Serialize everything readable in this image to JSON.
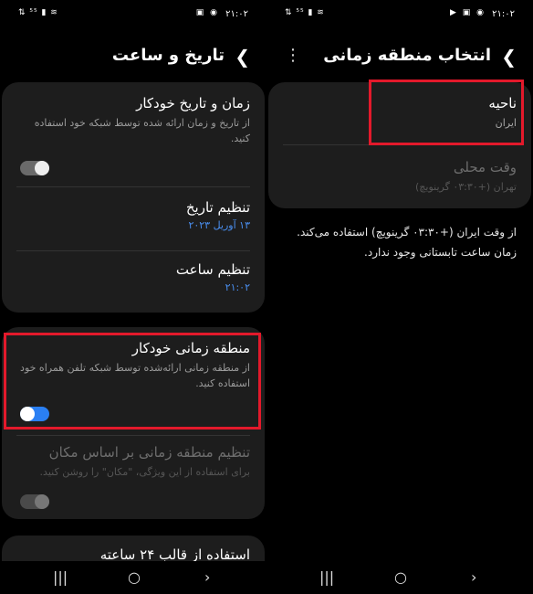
{
  "left_screen": {
    "status": {
      "time": "۲۱:۰۲",
      "left_icons": "⇅ ⁵⁵ ▮ ≋",
      "right_icons": "▣ ◉"
    },
    "header": {
      "title": "تاریخ و ساعت",
      "back_icon": "chevron-right-icon"
    },
    "card1": {
      "auto_datetime": {
        "title": "زمان و تاریخ خودکار",
        "subtitle": "از تاریخ و زمان ارائه شده توسط شبکه خود استفاده کنید."
      },
      "set_date": {
        "title": "تنظیم تاریخ",
        "value": "۱۳ آوریل ۲۰۲۳"
      },
      "set_time": {
        "title": "تنظیم ساعت",
        "value": "۲۱:۰۲"
      }
    },
    "card2": {
      "auto_timezone": {
        "title": "منطقه زمانی خودکار",
        "subtitle": "از منطقه زمانی ارائه‌شده توسط شبکه تلفن همراه خود استفاده کنید."
      },
      "location_timezone": {
        "title": "تنظیم منطقه زمانی بر اساس مکان",
        "subtitle": "برای استفاده از این ویژگی، \"مکان\" را روشن کنید."
      }
    },
    "card3": {
      "format24": {
        "title": "استفاده از قالب ۲۴ ساعته"
      }
    }
  },
  "right_screen": {
    "status": {
      "time": "۲۱:۰۲",
      "left_icons": "⇅ ⁵⁵ ▮ ≋",
      "right_icons": "▶ ▣ ◉"
    },
    "header": {
      "title": "انتخاب منطقه زمانی",
      "back_icon": "chevron-right-icon",
      "more_icon": "more-vertical-icon"
    },
    "region": {
      "title": "ناحیه",
      "value": "ایران"
    },
    "local_time": {
      "title": "وقت محلی",
      "value": "تهران (+۰۳:۳۰ گرینویچ)"
    },
    "description_line1": "از وقت ایران (+۰۳:۳۰ گرینویچ) استفاده می‌کند.",
    "description_line2": "زمان ساعت تابستانی وجود ندارد."
  },
  "navbar": {
    "recents": "|||",
    "home": "○",
    "back": "›"
  },
  "colors": {
    "accent": "#2a7ff3",
    "highlight": "#e3192b",
    "card": "#1d1d1d"
  }
}
